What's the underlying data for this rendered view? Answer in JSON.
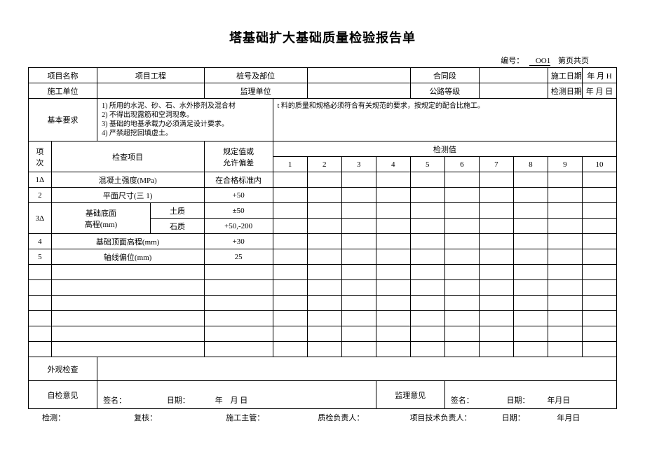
{
  "title": "塔基础扩大基础质量检验报告单",
  "id_label": "编号：",
  "id_value": "OO1",
  "page_label": "第页共页",
  "header": {
    "project_name": "项目名称",
    "project_eng": "项目工程",
    "pile_pos": "桩号及部位",
    "contract": "合同段",
    "construct_date": "施工日期",
    "date_val1": "年 月 H",
    "construct_unit": "施工单位",
    "supervise_unit": "监理单位",
    "road_grade": "公路等级",
    "test_date": "检测日期",
    "date_val2": "年 月 日"
  },
  "basic_req_label": "基本要求",
  "basic_req_left": "1) 所用的水泥、砂、石、水外掺剂及混合材\n2) 不得出现露筋和空洞现象。\n3) 基础的地基承载力必须满足设计要求。\n4) 严禁超挖回填虚土。",
  "basic_req_right": "t 料的质量和规格必须符合有关规范的要求，按规定的配合比施工。",
  "cols": {
    "seq": "项\n次",
    "check_item": "检查项目",
    "spec": "规定值或\n允许偏差",
    "vals": "检测值"
  },
  "nums": [
    "1",
    "2",
    "3",
    "4",
    "5",
    "6",
    "7",
    "8",
    "9",
    "10"
  ],
  "rows": [
    {
      "no": "1Δ",
      "item": "混凝土强度(MPa)",
      "sub": "",
      "spec": "在合格标准内"
    },
    {
      "no": "2",
      "item": "平面尺寸(三 1)",
      "sub": "",
      "spec": "+50"
    },
    {
      "no": "3Δ",
      "item": "基础底面\n高程(mm)",
      "sub1": "土质",
      "spec1": "±50",
      "sub2": "石质",
      "spec2": "+50,-200"
    },
    {
      "no": "4",
      "item": "基础顶面高程(mm)",
      "sub": "",
      "spec": "+30"
    },
    {
      "no": "5",
      "item": "轴线偏位(mm)",
      "sub": "",
      "spec": "25"
    }
  ],
  "appearance": "外观检查",
  "self_opinion": "自检意见",
  "supervise_opinion": "监理意见",
  "sign": "签名：",
  "date_lbl": "日期：",
  "date_fmt": "年　月 日",
  "date_fmt2": "年月日",
  "footer": {
    "check": "检测：",
    "review": "复核：",
    "construct_mgr": "施工主管：",
    "qc": "质检负责人：",
    "tech": "项目技术负责人：",
    "date": "日期：",
    "dval": "年月日"
  }
}
